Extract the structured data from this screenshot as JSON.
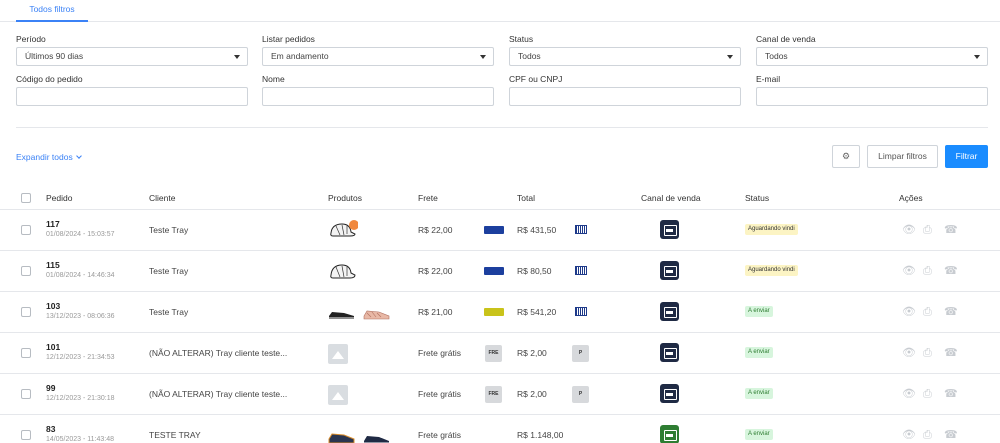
{
  "tabs": [
    {
      "label": "Todos filtros",
      "active": true
    }
  ],
  "filters": {
    "periodo": {
      "label": "Período",
      "value": "Últimos 90 dias"
    },
    "listar": {
      "label": "Listar pedidos",
      "value": "Em andamento"
    },
    "status": {
      "label": "Status",
      "value": "Todos"
    },
    "canal": {
      "label": "Canal de venda",
      "value": "Todos"
    },
    "codigo": {
      "label": "Código do pedido",
      "value": ""
    },
    "nome": {
      "label": "Nome",
      "value": ""
    },
    "cpf": {
      "label": "CPF ou CNPJ",
      "value": ""
    },
    "email": {
      "label": "E-mail",
      "value": ""
    }
  },
  "toolbar": {
    "expand_label": "Expandir todos",
    "settings_icon": "gear-icon",
    "clear_label": "Limpar filtros",
    "filter_label": "Filtrar"
  },
  "table": {
    "headers": {
      "pedido": "Pedido",
      "cliente": "Cliente",
      "produtos": "Produtos",
      "frete": "Frete",
      "total": "Total",
      "canal": "Canal de venda",
      "status": "Status",
      "acoes": "Ações"
    },
    "rows": [
      {
        "pedido": "117",
        "date": "01/08/2024 - 15:03:57",
        "cliente": "Teste Tray",
        "frete": "R$ 22,00",
        "total": "R$ 431,50",
        "status": "Aguardando vindi"
      },
      {
        "pedido": "115",
        "date": "01/08/2024 - 14:46:34",
        "cliente": "Teste Tray",
        "frete": "R$ 22,00",
        "total": "R$ 80,50",
        "status": "Aguardando vindi"
      },
      {
        "pedido": "103",
        "date": "13/12/2023 - 08:06:36",
        "cliente": "Teste Tray",
        "frete": "R$ 21,00",
        "total": "R$ 541,20",
        "status": "A enviar"
      },
      {
        "pedido": "101",
        "date": "12/12/2023 - 21:34:53",
        "cliente": "(NÃO ALTERAR) Tray cliente teste...",
        "frete": "Frete grátis",
        "ship_badge": "FRE",
        "total": "R$ 2,00",
        "pay_badge": "P",
        "status": "A enviar"
      },
      {
        "pedido": "99",
        "date": "12/12/2023 - 21:30:18",
        "cliente": "(NÃO ALTERAR) Tray cliente teste...",
        "frete": "Frete grátis",
        "ship_badge": "FRE",
        "total": "R$ 2,00",
        "pay_badge": "P",
        "status": "A enviar"
      },
      {
        "pedido": "83",
        "date": "14/05/2023 - 11:43:48",
        "cliente": "TESTE TRAY",
        "frete": "Frete grátis",
        "total": "R$ 1.148,00",
        "status": "A enviar"
      }
    ]
  },
  "icons": {
    "view": "eye-icon",
    "print": "printer-icon",
    "whatsapp": "whatsapp-icon"
  },
  "colors": {
    "accent": "#1a8cff",
    "status_wait_bg": "#fcf4c4",
    "status_send_bg": "#d7f5dd",
    "channel_store": "#1f2a44",
    "channel_whatsapp": "#2e7d32"
  }
}
